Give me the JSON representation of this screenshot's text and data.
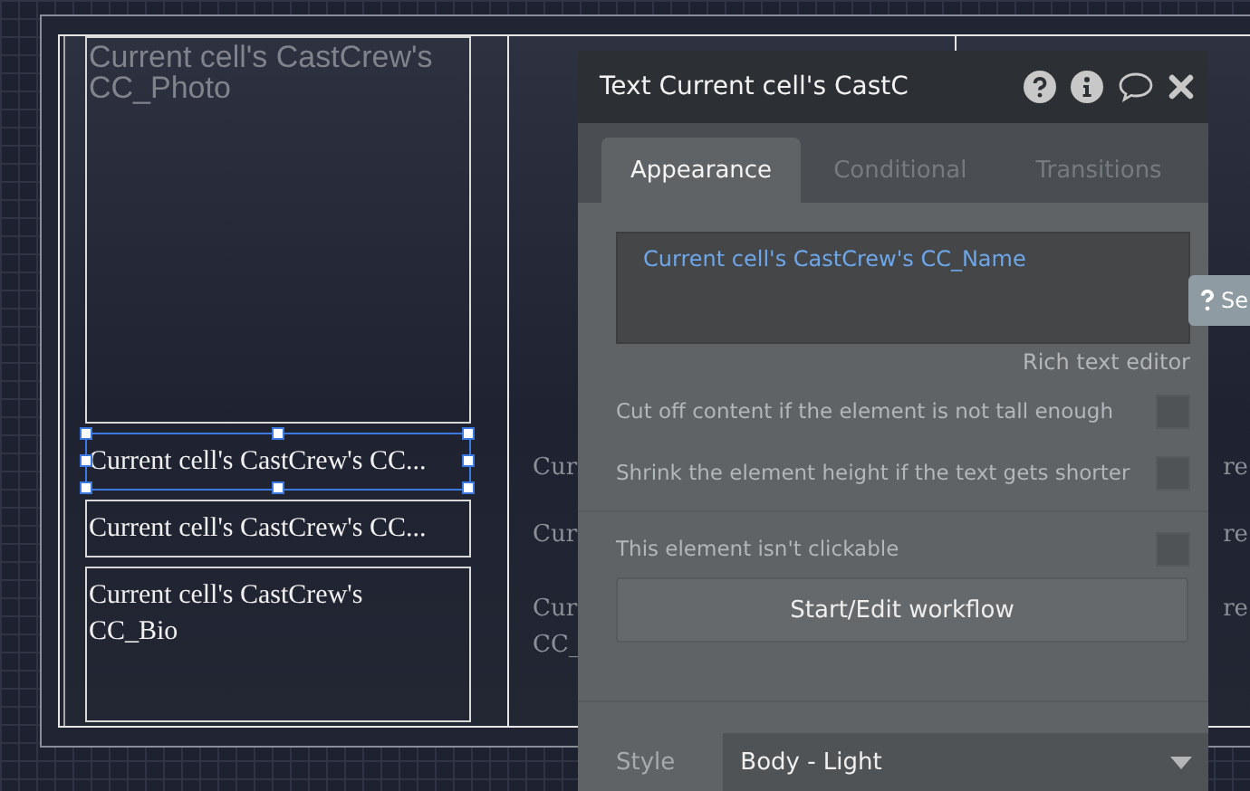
{
  "canvas": {
    "columns": [
      {
        "cells": [
          {
            "kind": "photo",
            "text": "Current cell's CastCrew's CC_Photo",
            "selected": false
          },
          {
            "kind": "line",
            "text": "Current cell's CastCrew's CC...",
            "selected": true
          },
          {
            "kind": "line",
            "text": "Current cell's CastCrew's CC...",
            "selected": false
          },
          {
            "kind": "bio",
            "text": "Current cell's CastCrew's CC_Bio",
            "selected": false
          }
        ]
      },
      {
        "cells": [
          {
            "kind": "line",
            "text": "Cur"
          },
          {
            "kind": "line",
            "text": "Cur"
          },
          {
            "kind": "bio",
            "text": "Cur CC_"
          }
        ]
      },
      {
        "cells": [
          {
            "kind": "line",
            "text": "re"
          },
          {
            "kind": "line",
            "text": "re"
          },
          {
            "kind": "bio",
            "text": "re"
          }
        ]
      }
    ]
  },
  "panel": {
    "title": "Text Current cell's CastC",
    "header_icons": [
      {
        "kind": "help"
      },
      {
        "kind": "info"
      },
      {
        "kind": "comment"
      },
      {
        "kind": "close"
      }
    ],
    "tabs": [
      {
        "label": "Appearance",
        "selected": true
      },
      {
        "label": "Conditional",
        "selected": false
      },
      {
        "label": "Transitions",
        "selected": false
      }
    ],
    "text_value": "Current cell's CastCrew's CC_Name",
    "rich_text_link": "Rich text editor",
    "option_groups": [
      [
        {
          "label": "Cut off content if the element is not tall enough",
          "checked": false
        },
        {
          "label": "Shrink the element height if the text gets shorter",
          "checked": false
        }
      ],
      [
        {
          "label": "This element isn't clickable",
          "checked": false
        }
      ]
    ],
    "workflow_button": "Start/Edit workflow",
    "style": {
      "label": "Style",
      "value": "Body - Light"
    }
  },
  "side_tab": {
    "label": "Se"
  }
}
